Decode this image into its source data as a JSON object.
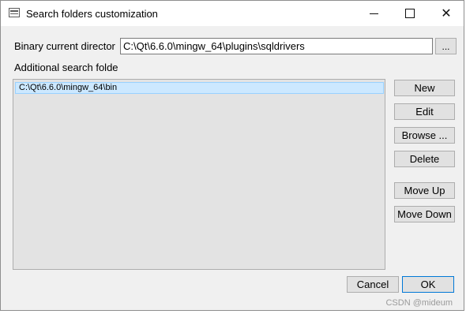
{
  "window": {
    "title": "Search folders customization",
    "controls": {
      "minimize": "minimize",
      "maximize": "maximize",
      "close": "✕"
    }
  },
  "binary": {
    "label": "Binary current director",
    "value": "C:\\Qt\\6.6.0\\mingw_64\\plugins\\sqldrivers",
    "browse_label": "..."
  },
  "additional": {
    "label": "Additional search folde",
    "items": [
      "C:\\Qt\\6.6.0\\mingw_64\\bin"
    ]
  },
  "buttons": {
    "new": "New",
    "edit": "Edit",
    "browse": "Browse ...",
    "delete": "Delete",
    "move_up": "Move Up",
    "move_down": "Move Down",
    "cancel": "Cancel",
    "ok": "OK"
  },
  "watermark": "CSDN @mideum"
}
